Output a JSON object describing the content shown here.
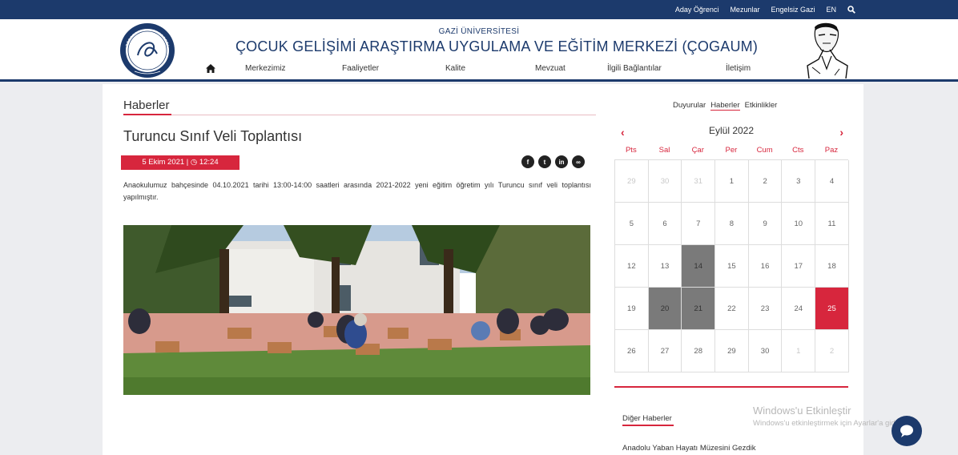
{
  "topbar": {
    "links": [
      "Aday Öğrenci",
      "Mezunlar",
      "Engelsiz Gazi",
      "EN"
    ]
  },
  "header": {
    "university": "GAZİ ÜNİVERSİTESİ",
    "center_title": "ÇOCUK GELİŞİMİ ARAŞTIRMA UYGULAMA VE EĞİTİM MERKEZİ (ÇOGAUM)",
    "nav": [
      "Merkezimiz",
      "Faaliyetler",
      "Kalite",
      "Mevzuat",
      "İlgili Bağlantılar",
      "İletişim"
    ]
  },
  "main": {
    "section_title": "Haberler",
    "article_title": "Turuncu Sınıf Veli Toplantısı",
    "date": "5 Ekim 2021 | ◷ 12:24",
    "body": "Anaokulumuz bahçesinde 04.10.2021 tarihi 13:00-14:00 saatleri arasında 2021-2022 yeni eğitim öğretim yılı Turuncu sınıf veli toplantısı yapılmıştır."
  },
  "sidebar": {
    "tabs": [
      "Duyurular",
      "Haberler",
      "Etkinlikler"
    ],
    "calendar": {
      "month": "Eylül 2022",
      "weekdays": [
        "Pts",
        "Sal",
        "Çar",
        "Per",
        "Cum",
        "Cts",
        "Paz"
      ],
      "weeks": [
        [
          "29",
          "30",
          "31",
          "1",
          "2",
          "3",
          "4"
        ],
        [
          "5",
          "6",
          "7",
          "8",
          "9",
          "10",
          "11"
        ],
        [
          "12",
          "13",
          "14",
          "15",
          "16",
          "17",
          "18"
        ],
        [
          "19",
          "20",
          "21",
          "22",
          "23",
          "24",
          "25"
        ],
        [
          "26",
          "27",
          "28",
          "29",
          "30",
          "1",
          "2"
        ]
      ]
    },
    "other_news_title": "Diğer Haberler",
    "other_news_item": "Anadolu Yaban Hayatı Müzesini Gezdik"
  },
  "watermark": {
    "line1": "Windows'u Etkinleştir",
    "line2": "Windows'u etkinleştirmek için Ayarlar'a gidin."
  },
  "colors": {
    "navy": "#1c3a6c",
    "accent": "#d7263d"
  }
}
